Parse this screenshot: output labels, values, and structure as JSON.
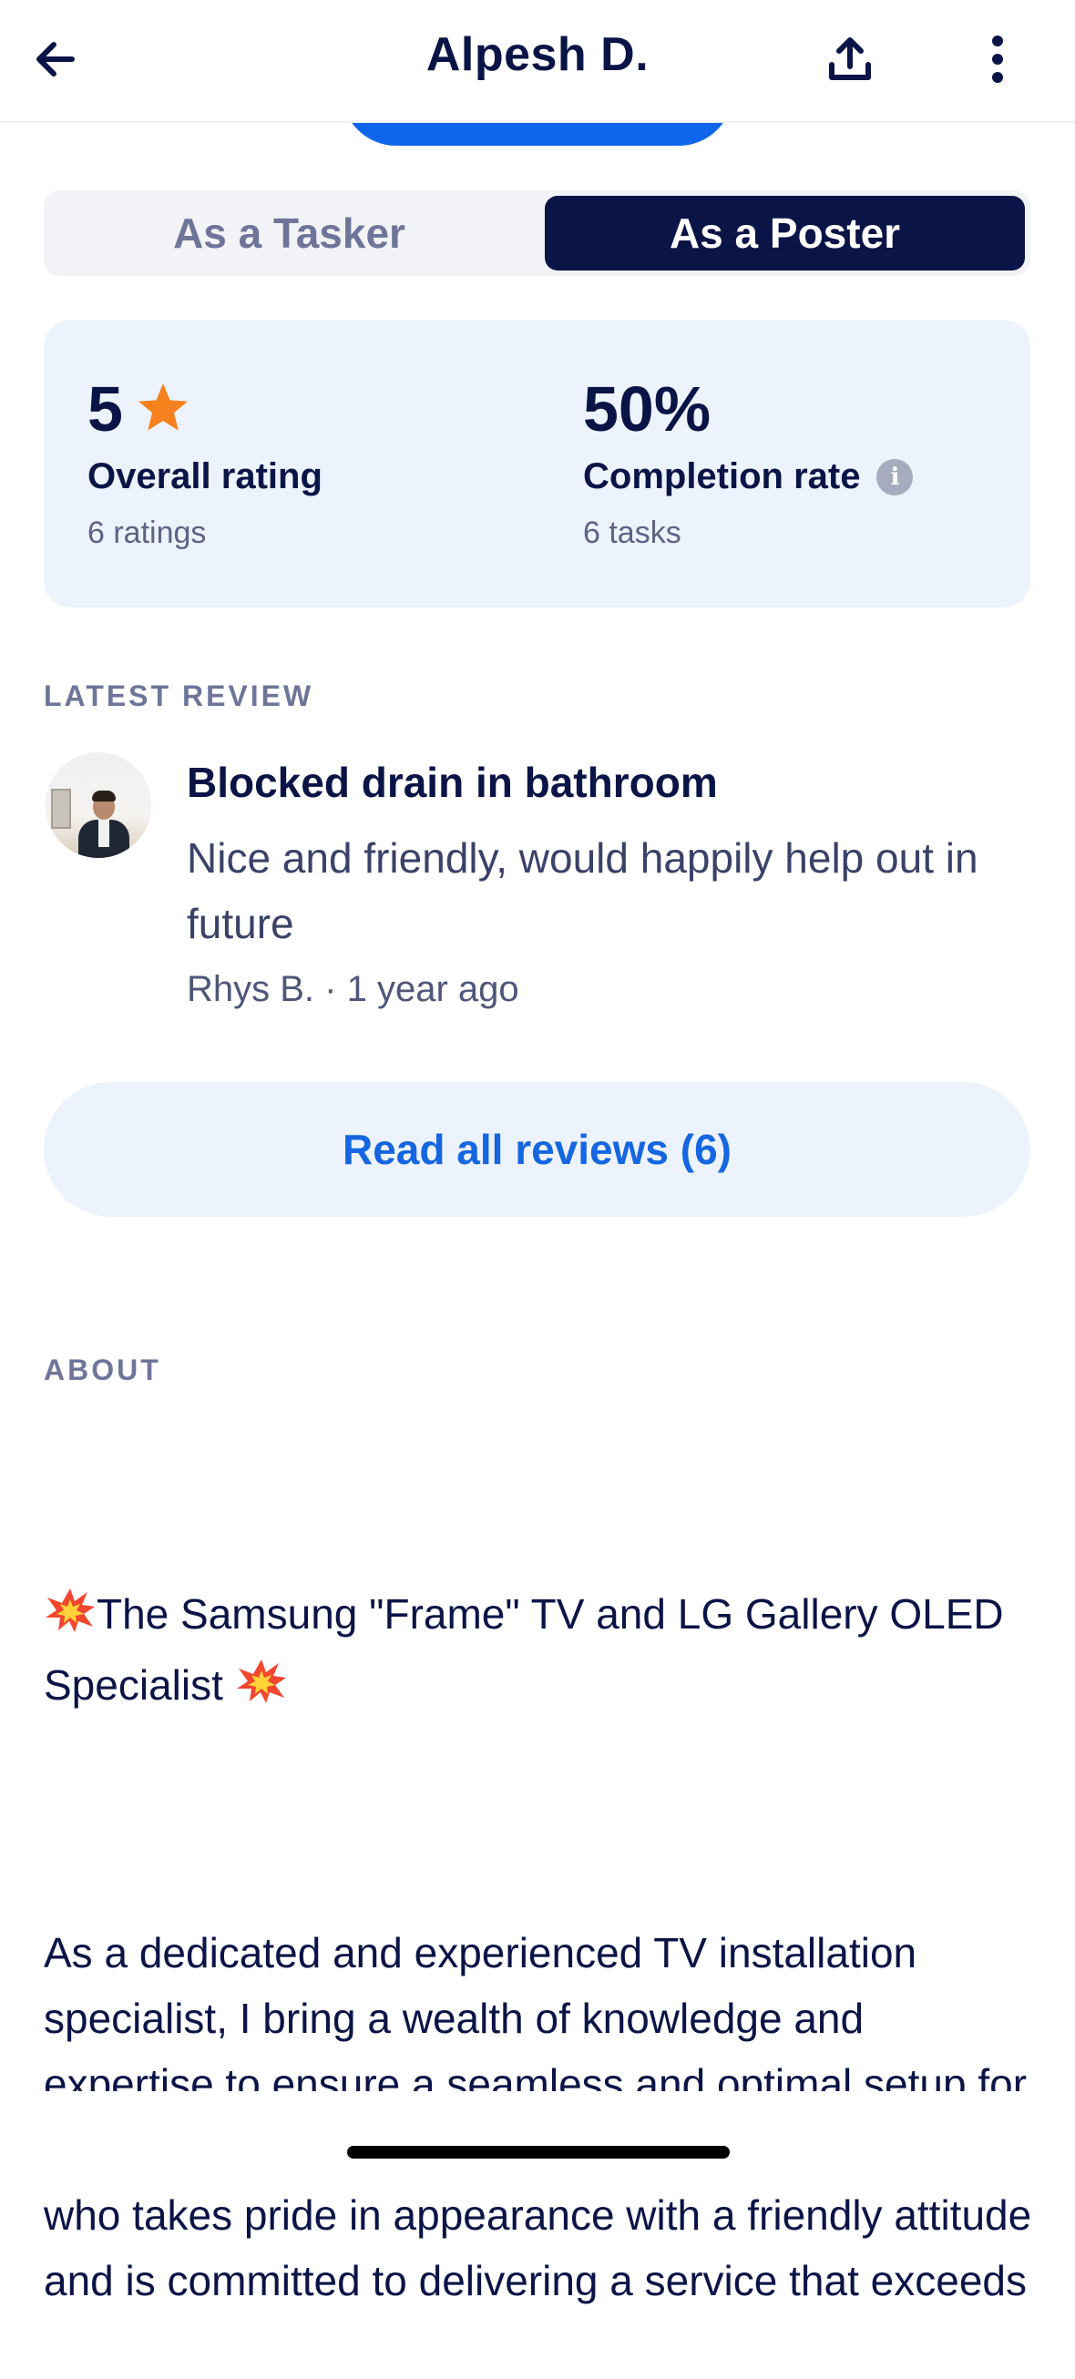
{
  "header": {
    "title": "Alpesh D.",
    "back_icon": "arrow-left-icon",
    "share_icon": "share-upload-icon",
    "more_icon": "more-vertical-icon"
  },
  "role_toggle": {
    "options": [
      "As a Tasker",
      "As a Poster"
    ],
    "selected": "As a Poster"
  },
  "stats": {
    "rating": {
      "value": "5",
      "label": "Overall rating",
      "sub": "6 ratings",
      "icon": "star-icon"
    },
    "completion": {
      "value": "50%",
      "label": "Completion rate",
      "sub": "6 tasks",
      "icon": "info-icon",
      "info_glyph": "i"
    }
  },
  "latest_review": {
    "heading": "LATEST REVIEW",
    "title": "Blocked drain in bathroom",
    "text": "Nice and friendly, would happily help out in future",
    "reviewer": "Rhys B.",
    "separator": " · ",
    "time": "1 year ago"
  },
  "read_all_button": "Read all reviews (6)",
  "about": {
    "heading": "ABOUT",
    "headline": "The Samsung \"Frame\" TV and LG Gallery OLED Specialist ",
    "body": "As a dedicated and experienced TV installation specialist, I bring a wealth of knowledge and expertise to ensure a seamless and optimal setup for your home or business.  I am a uniformed installer who takes pride in appearance with a friendly attitude and is committed to delivering a service that exceeds"
  },
  "colors": {
    "navy": "#0b1446",
    "brand_blue": "#0f66ec",
    "link_blue": "#1566e0",
    "card_bg": "#edf3fd",
    "star": "#f5821f",
    "muted": "#6e7599"
  }
}
